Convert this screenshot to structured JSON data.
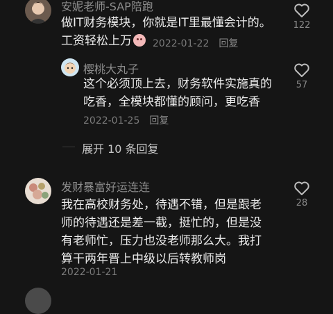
{
  "comments": [
    {
      "name": "安妮老师-SAP陪跑",
      "lines": [
        "做IT财务模块，你就是IT里最懂会计的。",
        "工资轻松上万"
      ],
      "emoji": "crying-face",
      "date": "2022-01-22",
      "reply_label": "回复",
      "likes": "122"
    },
    {
      "name": "樱桃大丸子",
      "lines": [
        "这个必须顶上去，财务软件实施真的",
        "吃香，全模块都懂的顾问，更吃香"
      ],
      "date": "2022-01-25",
      "reply_label": "回复",
      "likes": "57"
    },
    {
      "name": "发财暴富好运连连",
      "lines": [
        "我在高校财务处，待遇不错，但是跟老",
        "师的待遇还是差一截，挺忙的，但是没",
        "有老师忙，压力也没老师那么大。我打",
        "算干两年晋上中级以后转教师岗"
      ],
      "date": "2022-01-21",
      "reply_label": "",
      "likes": "28"
    }
  ],
  "expand_replies": "展开 10 条回复",
  "colors": {
    "background": "#151515",
    "text": "#ececec",
    "muted": "#8c8c8c"
  }
}
